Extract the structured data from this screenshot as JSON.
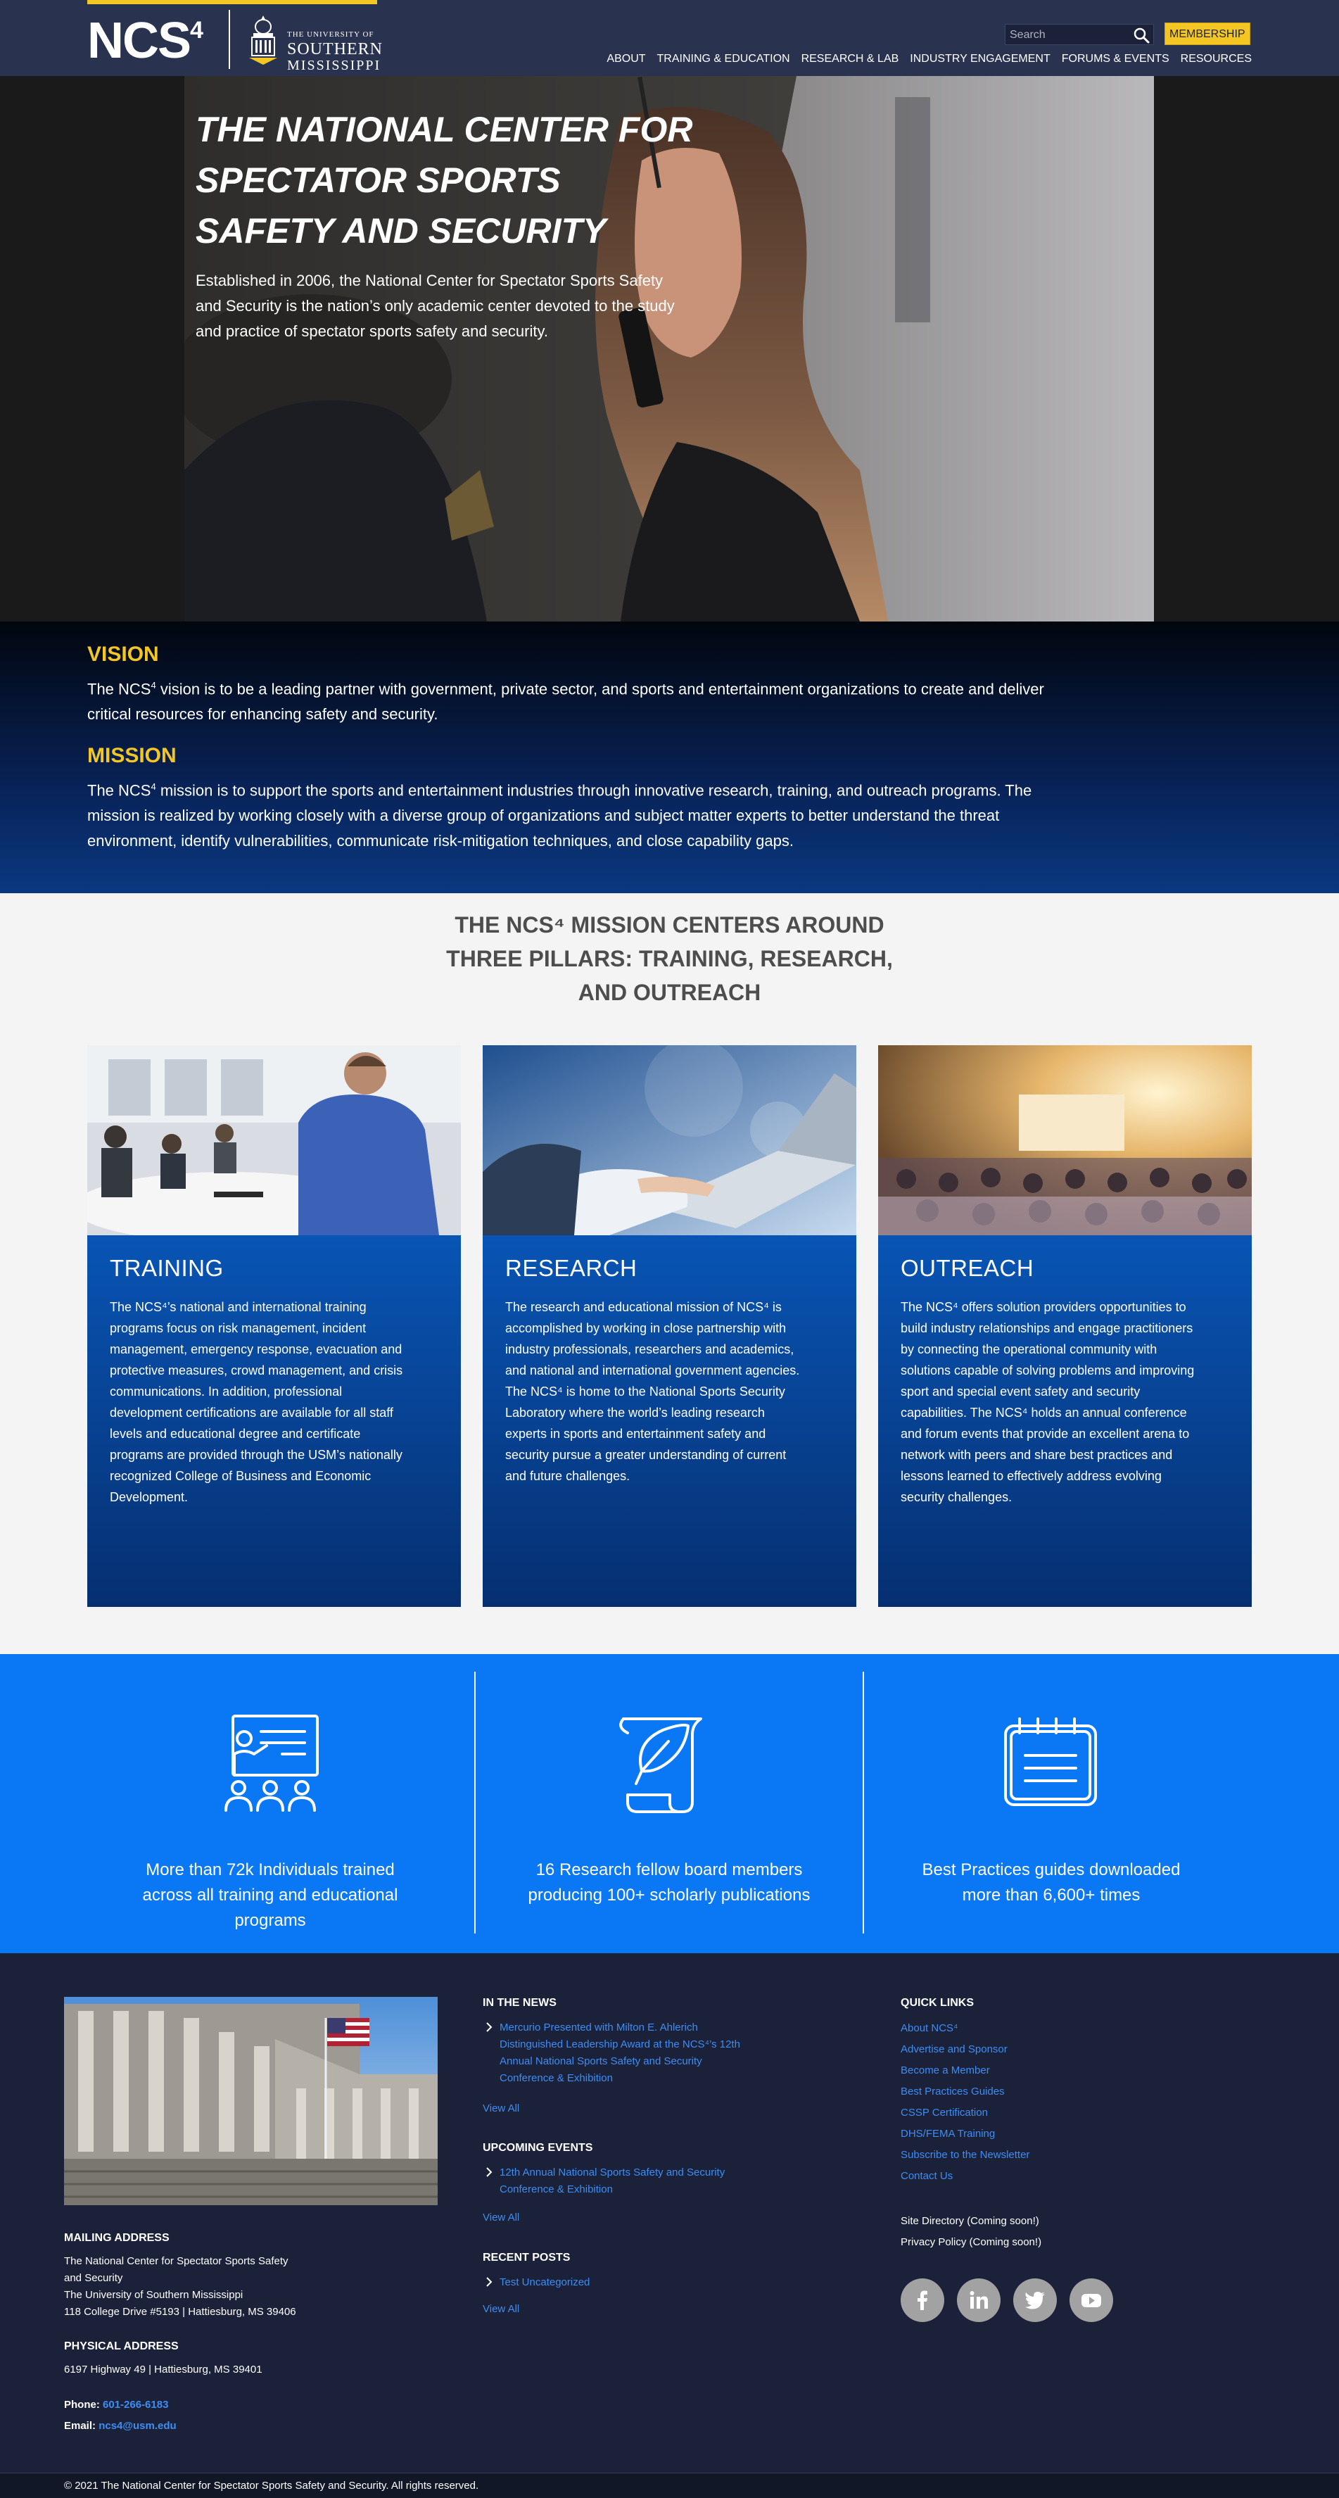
{
  "header": {
    "logo_text": "NCS",
    "logo_sup": "4",
    "usm": {
      "line1": "THE UNIVERSITY OF",
      "line2": "SOUTHERN",
      "line3": "MISSISSIPPI"
    },
    "search_placeholder": "Search",
    "membership_label": "MEMBERSHIP",
    "nav": [
      "ABOUT",
      "TRAINING & EDUCATION",
      "RESEARCH & LAB",
      "INDUSTRY ENGAGEMENT",
      "FORUMS & EVENTS",
      "RESOURCES"
    ]
  },
  "hero": {
    "title_lines": [
      "THE NATIONAL CENTER FOR",
      "SPECTATOR SPORTS",
      "SAFETY AND SECURITY"
    ],
    "text": "Established in 2006, the National Center for Spectator Sports Safety and Security is the nation’s only academic center devoted to the study and practice of spectator sports safety and security."
  },
  "vision": {
    "heading": "VISION",
    "pre": "The NCS",
    "sup": "4",
    "text": " vision is to be a leading partner with government, private sector, and sports and entertainment organizations to create and deliver critical resources for enhancing safety and security."
  },
  "mission": {
    "heading": "MISSION",
    "pre": "The NCS",
    "sup": "4",
    "text": " mission is to support the sports and entertainment industries through innovative research, training, and outreach programs. The mission is realized by working closely with a diverse group of organizations and subject matter experts to better understand the threat environment, identify vulnerabilities, communicate risk-mitigation techniques, and close capability gaps."
  },
  "pillars": {
    "title_lines": [
      "THE NCS⁴ MISSION CENTERS AROUND",
      "THREE PILLARS: TRAINING, RESEARCH,",
      "AND OUTREACH"
    ],
    "cards": [
      {
        "title": "TRAINING",
        "text": "The NCS⁴’s national and international training programs focus on risk management, incident management, emergency response, evacuation and protective measures, crowd management, and crisis communications. In addition, professional development certifications are available for all staff levels and educational degree and certificate programs are provided through the USM’s nationally recognized College of Business and Economic Development."
      },
      {
        "title": "RESEARCH",
        "text": "The research and educational mission of NCS⁴ is accomplished by working in close partnership with industry professionals, researchers and academics, and national and international government agencies. The NCS⁴ is home to the National Sports Security Laboratory where the world’s leading research experts in sports and entertainment safety and security pursue a greater understanding of current and future challenges."
      },
      {
        "title": "OUTREACH",
        "text": "The NCS⁴ offers solution providers opportunities to build industry relationships and engage practitioners by connecting the operational community with solutions capable of solving problems and improving sport and special event safety and security capabilities. The NCS⁴ holds an annual conference and forum events that provide an excellent arena to network with peers and share best practices and lessons learned to effectively address evolving security challenges."
      }
    ]
  },
  "stats": [
    {
      "icon": "presentation-icon",
      "text": "More than 72k Individuals trained across all training and educational programs"
    },
    {
      "icon": "scroll-quill-icon",
      "text": "16 Research fellow board members producing 100+ scholarly publications"
    },
    {
      "icon": "notepad-icon",
      "text": "Best Practices guides downloaded more than 6,600+ times"
    }
  ],
  "footer": {
    "mailing_heading": "MAILING ADDRESS",
    "mailing_lines": [
      "The National Center for Spectator Sports Safety",
      "and Security",
      "The University of Southern Mississippi",
      "118 College Drive #5193 | Hattiesburg, MS 39406"
    ],
    "physical_heading": "PHYSICAL ADDRESS",
    "physical_line": "6197 Highway 49 | Hattiesburg, MS 39401",
    "phone_label": "Phone:",
    "phone": "601-266-6183",
    "email_label": "Email:",
    "email": "ncs4@usm.edu",
    "news_heading": "IN THE NEWS",
    "news_item": "Mercurio Presented with Milton E. Ahlerich Distinguished Leadership Award at the NCS⁴’s 12th Annual National Sports Safety and Security Conference & Exhibition",
    "events_heading": "UPCOMING EVENTS",
    "events_item": "12th Annual National Sports Safety and Security Conference & Exhibition",
    "posts_heading": "RECENT POSTS",
    "posts_item": "Test Uncategorized",
    "view_all": "View All",
    "quick_heading": "QUICK LINKS",
    "quick_links": [
      "About NCS⁴",
      "Advertise and Sponsor",
      "Become a Member",
      "Best Practices Guides",
      "CSSP Certification",
      "DHS/FEMA Training",
      "Subscribe to the Newsletter",
      "Contact Us"
    ],
    "site_directory": "Site Directory (Coming soon!)",
    "privacy": "Privacy Policy (Coming soon!)",
    "social": [
      "facebook-icon",
      "linkedin-icon",
      "twitter-icon",
      "youtube-icon"
    ],
    "copyright": "© 2021 The National Center for Spectator Sports Safety and Security. All rights reserved."
  },
  "colors": {
    "navy": "#293350",
    "gold": "#f3c623",
    "blue": "#0a78f5",
    "footer": "#1b2138",
    "link": "#3d8df5"
  }
}
